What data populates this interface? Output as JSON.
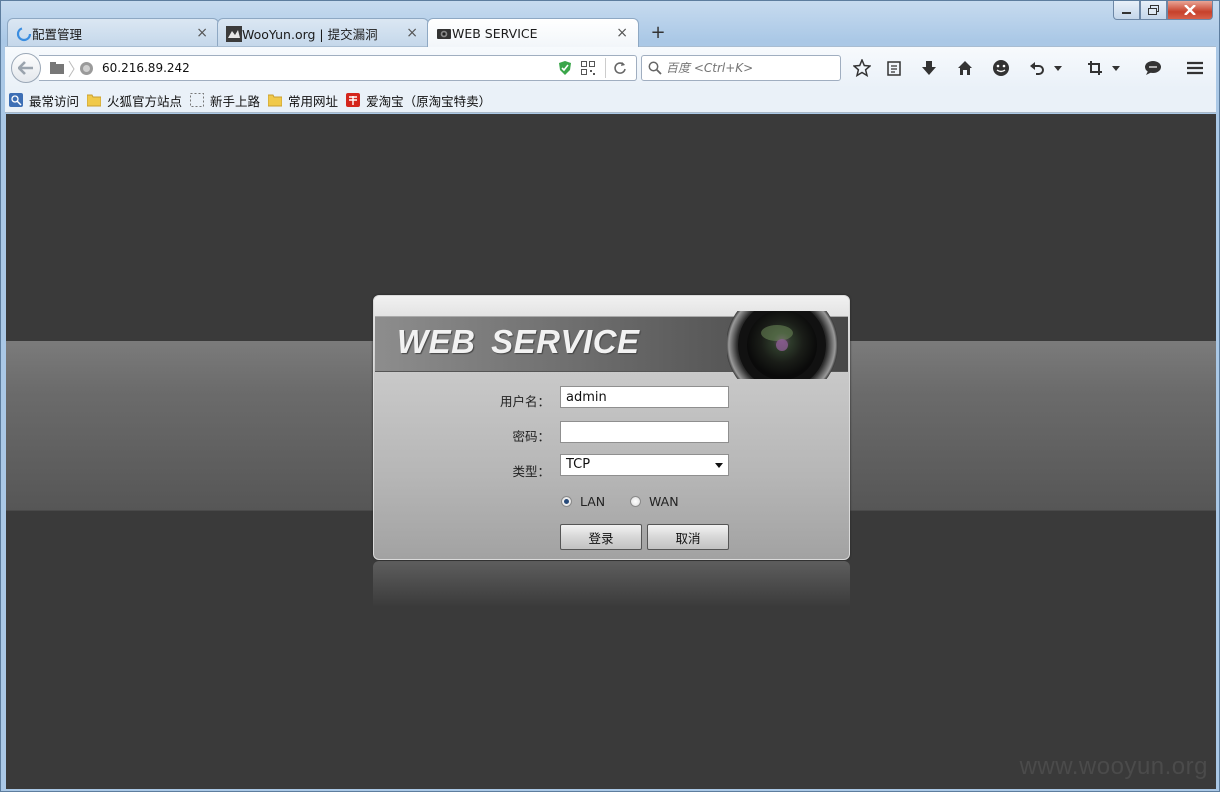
{
  "browser": {
    "tabs": [
      {
        "title": "配置管理",
        "icon": "loading-spinner-icon"
      },
      {
        "title": "WooYun.org | 提交漏洞",
        "icon": "wooyun-site-icon"
      },
      {
        "title": "WEB SERVICE",
        "icon": "camera-site-icon"
      }
    ],
    "new_tab": "+",
    "close_glyph": "×",
    "url": "60.216.89.242",
    "search_placeholder": "百度 <Ctrl+K>",
    "bookmarks": [
      {
        "label": "最常访问",
        "icon": "most-visited-icon"
      },
      {
        "label": "火狐官方站点",
        "icon": "folder-icon"
      },
      {
        "label": "新手上路",
        "icon": "dashed-box-icon"
      },
      {
        "label": "常用网址",
        "icon": "folder-icon"
      },
      {
        "label": "爱淘宝（原淘宝特卖）",
        "icon": "taobao-icon"
      }
    ]
  },
  "login": {
    "title": "WEB  SERVICE",
    "username_label": "用户名：",
    "username_value": "admin",
    "password_label": "密码：",
    "password_value": "",
    "type_label": "类型：",
    "type_value": "TCP",
    "radio_lan": "LAN",
    "radio_wan": "WAN",
    "selected_network": "LAN",
    "login_button": "登录",
    "cancel_button": "取消"
  },
  "watermark": "www.wooyun.org"
}
